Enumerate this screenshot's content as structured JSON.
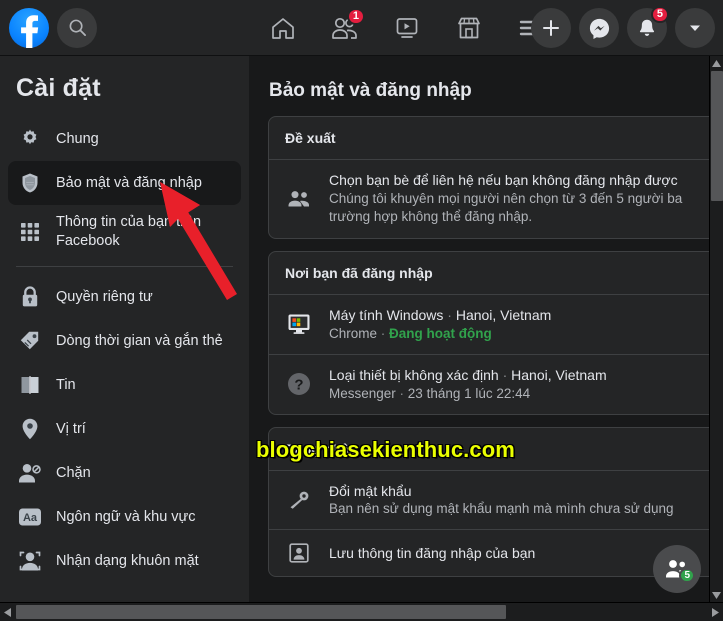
{
  "topbar": {
    "logo": "facebook-logo",
    "search_label": "Search",
    "nav": [
      {
        "name": "home",
        "icon": "home-icon",
        "badge": ""
      },
      {
        "name": "friends",
        "icon": "friends-icon",
        "badge": "1"
      },
      {
        "name": "watch",
        "icon": "watch-video-icon",
        "badge": ""
      },
      {
        "name": "marketplace",
        "icon": "marketplace-icon",
        "badge": ""
      },
      {
        "name": "menu",
        "icon": "hamburger-menu-icon",
        "badge": ""
      }
    ],
    "right": [
      {
        "name": "create",
        "icon": "plus-icon",
        "badge": ""
      },
      {
        "name": "messenger",
        "icon": "messenger-icon",
        "badge": ""
      },
      {
        "name": "notifications",
        "icon": "bell-icon",
        "badge": "5"
      },
      {
        "name": "account",
        "icon": "chevron-down-icon",
        "badge": ""
      }
    ]
  },
  "sidebar": {
    "title": "Cài đặt",
    "items": [
      {
        "label": "Chung",
        "icon": "gear-icon",
        "active": false
      },
      {
        "label": "Bảo mật và đăng nhập",
        "icon": "shield-icon",
        "active": true
      },
      {
        "label": "Thông tin của bạn trên Facebook",
        "icon": "grid-icon",
        "active": false
      },
      {
        "label": "Quyền riêng tư",
        "icon": "lock-icon",
        "active": false
      },
      {
        "label": "Dòng thời gian và gắn thẻ",
        "icon": "tag-icon",
        "active": false
      },
      {
        "label": "Tin",
        "icon": "book-icon",
        "active": false
      },
      {
        "label": "Vị trí",
        "icon": "location-pin-icon",
        "active": false
      },
      {
        "label": "Chặn",
        "icon": "block-user-icon",
        "active": false
      },
      {
        "label": "Ngôn ngữ và khu vực",
        "icon": "language-aa-icon",
        "active": false
      },
      {
        "label": "Nhận dạng khuôn mặt",
        "icon": "face-recognition-icon",
        "active": false
      }
    ],
    "divider_after_index": 2
  },
  "main": {
    "page_title": "Bảo mật và đăng nhập",
    "cards": [
      {
        "id": "suggestions",
        "heading": "Đề xuất",
        "rows": [
          {
            "icon": "two-people-icon",
            "title": "Chọn bạn bè để liên hệ nếu bạn không đăng nhập được",
            "sub": "Chúng tôi khuyên mọi người nên chọn từ 3 đến 5 người ba\ntrường hợp không thể đăng nhập."
          }
        ]
      },
      {
        "id": "where-logged-in",
        "heading": "Nơi bạn đã đăng nhập",
        "rows": [
          {
            "icon": "windows-computer-icon",
            "title": "Máy tính Windows",
            "location": "Hanoi, Vietnam",
            "browser": "Chrome",
            "status": "Đang hoạt động"
          },
          {
            "icon": "unknown-device-icon",
            "title": "Loại thiết bị không xác định",
            "location": "Hanoi, Vietnam",
            "browser": "Messenger",
            "status": "23 tháng 1 lúc 22:44"
          }
        ]
      },
      {
        "id": "login",
        "heading": "Đăng nhập",
        "rows": [
          {
            "icon": "key-icon",
            "title": "Đổi mật khẩu",
            "sub": "Bạn nên sử dụng mật khẩu mạnh mà mình chưa sử dụng"
          },
          {
            "icon": "save-credentials-icon",
            "title": "Lưu thông tin đăng nhập của bạn",
            "sub": ""
          }
        ]
      }
    ],
    "separator": " · "
  },
  "watermark": {
    "text": "blogchiasekienthuc.com",
    "color": "#eaff00"
  },
  "fab": {
    "icon": "contacts-icon",
    "badge": "5"
  },
  "colors": {
    "page_bg": "#18191a",
    "surface": "#242526",
    "border": "#3e4042",
    "text_primary": "#e4e6eb",
    "text_secondary": "#b0b3b8",
    "accent_blue": "#0a84ff",
    "accent_green": "#31a24c",
    "badge_red": "#e41e3f",
    "arrow_red": "#e8202a"
  }
}
